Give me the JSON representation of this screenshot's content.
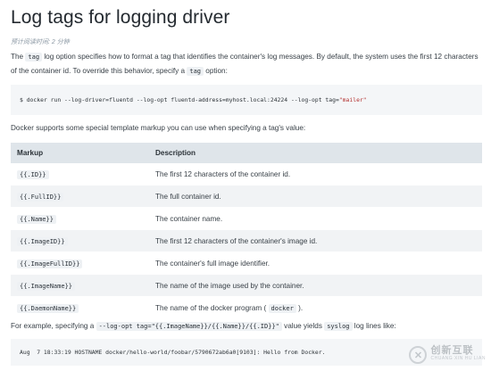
{
  "title": "Log tags for logging driver",
  "read_time": "预计阅读时间: 2 分钟",
  "intro": {
    "p1": "The ",
    "code1": "tag",
    "p2": " log option specifies how to format a tag that identifies the container's log messages. By default, the system uses the first 12 characters of the container id. To override this behavior, specify a ",
    "code2": "tag",
    "p3": " option:"
  },
  "code_example": {
    "command": "$ docker run --log-driver=fluentd --log-opt fluentd-address=myhost.local:24224 --log-opt tag=",
    "string": "\"mailer\""
  },
  "template_intro": "Docker supports some special template markup you can use when specifying a tag's value:",
  "table": {
    "headers": [
      "Markup",
      "Description"
    ],
    "rows": [
      {
        "markup": "{{.ID}}",
        "desc": "The first 12 characters of the container id."
      },
      {
        "markup": "{{.FullID}}",
        "desc": "The full container id."
      },
      {
        "markup": "{{.Name}}",
        "desc": "The container name."
      },
      {
        "markup": "{{.ImageID}}",
        "desc": "The first 12 characters of the container's image id."
      },
      {
        "markup": "{{.ImageFullID}}",
        "desc": "The container's full image identifier."
      },
      {
        "markup": "{{.ImageName}}",
        "desc": "The name of the image used by the container."
      },
      {
        "markup": "{{.DaemonName}}",
        "desc_pre": "The name of the docker program ( ",
        "desc_code": "docker",
        "desc_post": " )."
      }
    ]
  },
  "example": {
    "p1": "For example, specifying a ",
    "code1": "--log-opt tag=\"{{.ImageName}}/{{.Name}}/{{.ID}}\"",
    "p2": " value yields ",
    "code2": "syslog",
    "p3": " log lines like:"
  },
  "log_line": "Aug  7 18:33:19 HOSTNAME docker/hello-world/foobar/5790672ab6a0[9103]: Hello from Docker.",
  "watermark": {
    "icon": "chuangxin-logo-icon",
    "name": "创新互联",
    "sub": "CHUANG XIN HU LIAN"
  }
}
